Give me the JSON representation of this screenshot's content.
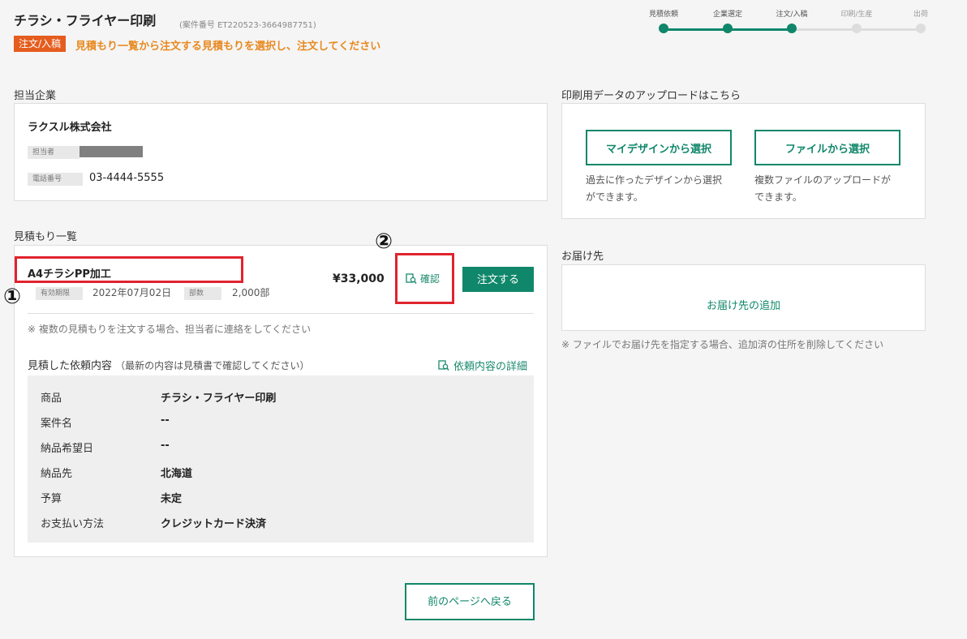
{
  "header": {
    "title": "チラシ・フライヤー印刷",
    "case_number": "(案件番号 ET220523-3664987751)",
    "status_badge": "注文/入稿",
    "instruction": "見積もり一覧から注文する見積もりを選択し、注文してください"
  },
  "progress": {
    "steps": [
      {
        "label": "見積依頼",
        "state": "done"
      },
      {
        "label": "企業選定",
        "state": "done"
      },
      {
        "label": "注文/入稿",
        "state": "current"
      },
      {
        "label": "印刷/生産",
        "state": "pending"
      },
      {
        "label": "出荷",
        "state": "pending"
      }
    ]
  },
  "company": {
    "section_label": "担当企業",
    "name": "ラクスル株式会社",
    "contact_tag": "担当者",
    "phone_tag": "電話番号",
    "phone": "03-4444-5555"
  },
  "quotes": {
    "section_label": "見積もり一覧",
    "items": [
      {
        "name": "A4チラシPP加工",
        "expiry_tag": "有効期限",
        "expiry": "2022年07月02日",
        "qty_tag": "部数",
        "qty": "2,000部",
        "price": "¥33,000",
        "confirm_label": "確認",
        "order_label": "注文する"
      }
    ],
    "note": "※ 複数の見積もりを注文する場合、担当者に連絡をしてください",
    "request_title": "見積した依頼内容",
    "request_subtitle": "（最新の内容は見積書で確認してください）",
    "detail_link": "依頼内容の詳細",
    "rows": [
      {
        "label": "商品",
        "value": "チラシ・フライヤー印刷"
      },
      {
        "label": "案件名",
        "value": "--"
      },
      {
        "label": "納品希望日",
        "value": "--"
      },
      {
        "label": "納品先",
        "value": "北海道"
      },
      {
        "label": "予算",
        "value": "未定"
      },
      {
        "label": "お支払い方法",
        "value": "クレジットカード決済"
      }
    ]
  },
  "upload": {
    "section_label": "印刷用データのアップロードはこちら",
    "my_design_button": "マイデザインから選択",
    "my_design_desc_1": "過去に作ったデザインから選択",
    "my_design_desc_2": "ができます。",
    "file_button": "ファイルから選択",
    "file_desc_1": "複数ファイルのアップロードが",
    "file_desc_2": "できます。"
  },
  "delivery": {
    "section_label": "お届け先",
    "add_link": "お届け先の追加",
    "note": "※ ファイルでお届け先を指定する場合、追加済の住所を削除してください"
  },
  "annotations": {
    "marker_1": "①",
    "marker_2": "②"
  },
  "footer": {
    "back_button": "前のページへ戻る"
  },
  "colors": {
    "brand_green": "#10876a",
    "badge_orange": "#e55d1e",
    "instruction_orange": "#e8891f",
    "highlight_red": "#e0232e",
    "step_pending": "#dddddd"
  }
}
